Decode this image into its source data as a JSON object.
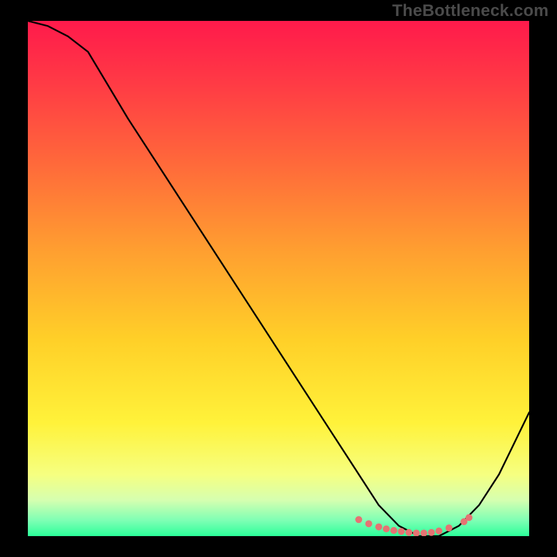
{
  "watermark": "TheBottleneck.com",
  "chart_data": {
    "type": "line",
    "title": "",
    "xlabel": "",
    "ylabel": "",
    "xlim": [
      0,
      100
    ],
    "ylim": [
      0,
      100
    ],
    "background_gradient": {
      "stops": [
        {
          "offset": 0.0,
          "color": "#ff1a4b"
        },
        {
          "offset": 0.12,
          "color": "#ff3a45"
        },
        {
          "offset": 0.28,
          "color": "#ff6a3a"
        },
        {
          "offset": 0.45,
          "color": "#ffa030"
        },
        {
          "offset": 0.62,
          "color": "#ffd028"
        },
        {
          "offset": 0.78,
          "color": "#fff23a"
        },
        {
          "offset": 0.88,
          "color": "#f6ff80"
        },
        {
          "offset": 0.93,
          "color": "#d6ffb0"
        },
        {
          "offset": 0.97,
          "color": "#7dffb4"
        },
        {
          "offset": 1.0,
          "color": "#2bff9a"
        }
      ]
    },
    "series": [
      {
        "name": "bottleneck-curve",
        "x": [
          0,
          4,
          8,
          12,
          20,
          30,
          40,
          50,
          60,
          66,
          70,
          74,
          78,
          82,
          86,
          90,
          94,
          100
        ],
        "y": [
          100,
          99,
          97,
          94,
          81,
          66,
          51,
          36,
          21,
          12,
          6,
          2,
          0,
          0,
          2,
          6,
          12,
          24
        ],
        "stroke": "#000000",
        "stroke_width": 2.4
      }
    ],
    "scatter": {
      "name": "valley-dots",
      "color": "#e57373",
      "radius": 5,
      "points": [
        {
          "x": 66,
          "y": 3.2
        },
        {
          "x": 68,
          "y": 2.4
        },
        {
          "x": 70,
          "y": 1.8
        },
        {
          "x": 71.5,
          "y": 1.4
        },
        {
          "x": 73,
          "y": 1.1
        },
        {
          "x": 74.5,
          "y": 0.9
        },
        {
          "x": 76,
          "y": 0.7
        },
        {
          "x": 77.5,
          "y": 0.6
        },
        {
          "x": 79,
          "y": 0.6
        },
        {
          "x": 80.5,
          "y": 0.7
        },
        {
          "x": 82,
          "y": 1.0
        },
        {
          "x": 84,
          "y": 1.6
        },
        {
          "x": 87,
          "y": 2.8
        },
        {
          "x": 88,
          "y": 3.6
        }
      ]
    }
  }
}
